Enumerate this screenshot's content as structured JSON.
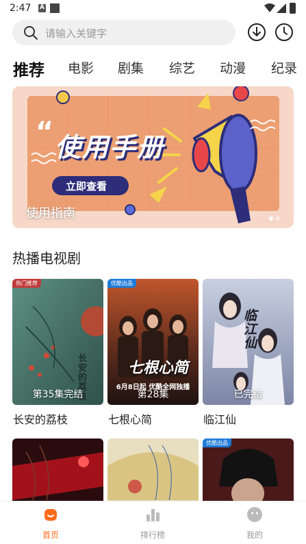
{
  "status_bar": {
    "time": "2:47"
  },
  "search": {
    "placeholder": "请输入关键字"
  },
  "tabs": [
    {
      "label": "推荐",
      "active": true
    },
    {
      "label": "电影"
    },
    {
      "label": "剧集"
    },
    {
      "label": "综艺"
    },
    {
      "label": "动漫"
    },
    {
      "label": "纪录"
    }
  ],
  "banner": {
    "headline": "使用手册",
    "button_label": "立即查看",
    "caption": "使用指南",
    "page_count": 2,
    "current_page": 1
  },
  "hot_tv": {
    "title": "热播电视剧",
    "items": [
      {
        "title": "长安的荔枝",
        "episode": "第35集完结",
        "badge": "热门推荐",
        "poster_text": "长安的荔枝",
        "badge_color": "#c23b3b"
      },
      {
        "title": "七根心简",
        "episode": "第28集",
        "badge": "优酷出品",
        "poster_text": "七根心简",
        "promo": "6月8日起 优酷全网独播",
        "badge_color": "#1f7bd8"
      },
      {
        "title": "临江仙",
        "episode": "已完结",
        "badge": "",
        "poster_text": "临江仙"
      },
      {
        "title": "",
        "episode": "",
        "badge": ""
      },
      {
        "title": "",
        "episode": "",
        "badge": ""
      },
      {
        "title": "",
        "episode": "",
        "badge": "优酷出品",
        "badge_color": "#1f7bd8"
      }
    ]
  },
  "bottom_nav": [
    {
      "label": "首页",
      "icon": "home-icon",
      "active": true
    },
    {
      "label": "排行榜",
      "icon": "ranking-icon"
    },
    {
      "label": "我的",
      "icon": "profile-icon"
    }
  ],
  "colors": {
    "accent": "#ff6a1a",
    "inactive": "#999999",
    "banner_bg": "#f7d6c6"
  }
}
